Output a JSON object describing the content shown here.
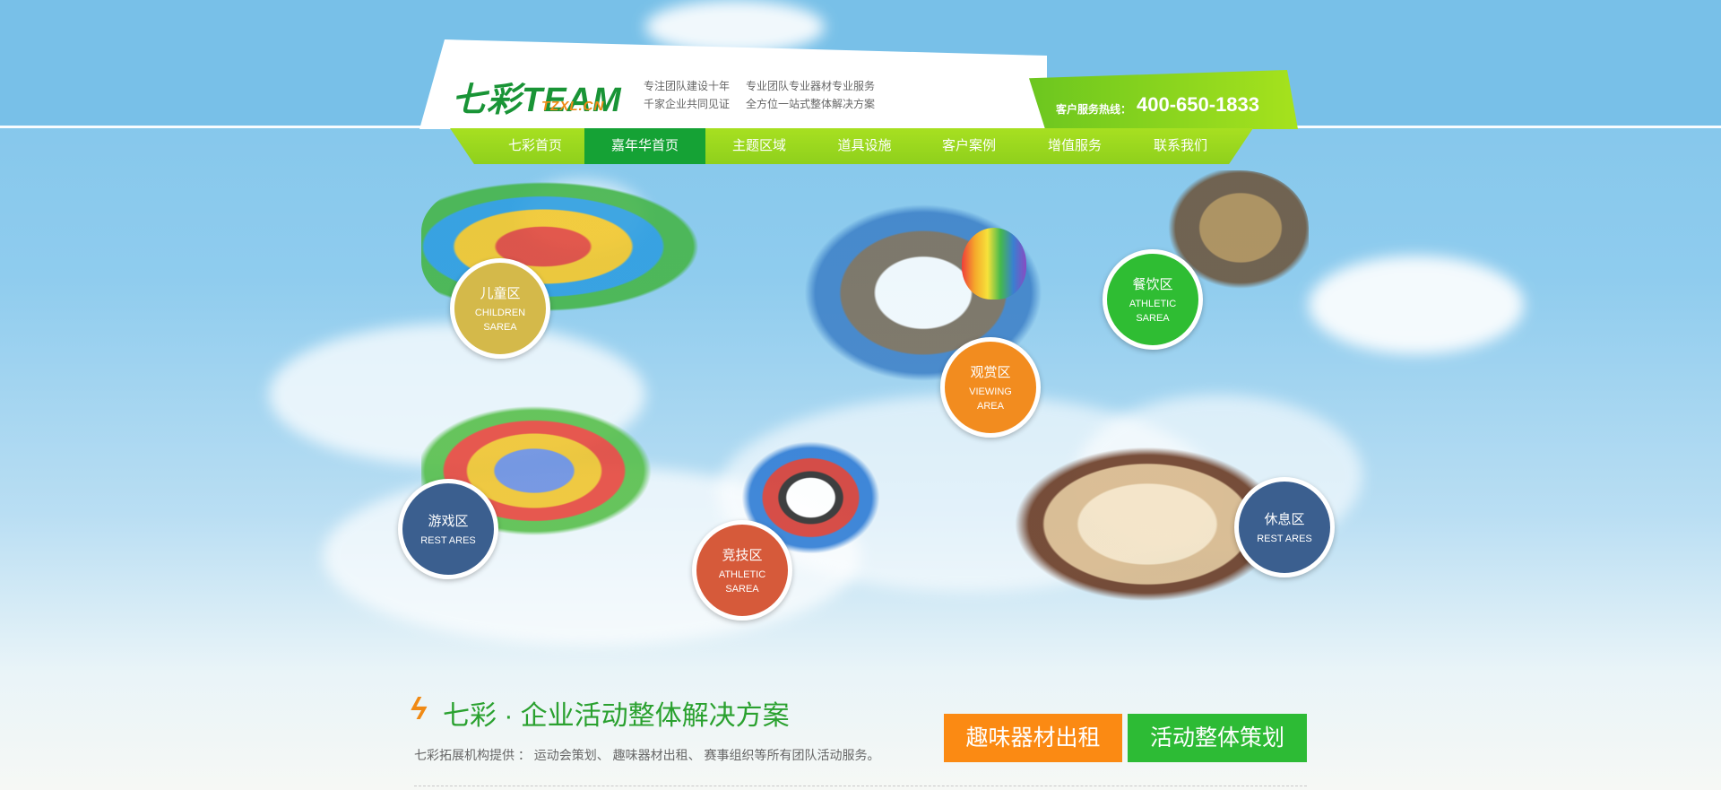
{
  "header": {
    "logo_main": "七彩TEAM",
    "logo_sub": "TZXL.CN",
    "slogans": [
      "专注团队建设十年",
      "专业团队专业器材专业服务",
      "千家企业共同见证",
      "全方位一站式整体解决方案"
    ],
    "hotline_label": "客户服务热线：",
    "hotline_number": "400-650-1833"
  },
  "nav": {
    "items": [
      {
        "label": "七彩首页",
        "active": false
      },
      {
        "label": "嘉年华首页",
        "active": true
      },
      {
        "label": "主题区域",
        "active": false
      },
      {
        "label": "道具设施",
        "active": false
      },
      {
        "label": "客户案例",
        "active": false
      },
      {
        "label": "增值服务",
        "active": false
      },
      {
        "label": "联系我们",
        "active": false
      }
    ]
  },
  "zones": [
    {
      "name": "儿童区",
      "en": "CHILDREN SAREA",
      "color": "#d4b94a"
    },
    {
      "name": "观赏区",
      "en": "VIEWING AREA",
      "color": "#f28c1f"
    },
    {
      "name": "餐饮区",
      "en": "ATHLETIC SAREA",
      "color": "#2fbd33"
    },
    {
      "name": "游戏区",
      "en": "REST ARES",
      "color": "#3b5f8f"
    },
    {
      "name": "竞技区",
      "en": "ATHLETIC SAREA",
      "color": "#d65a3a"
    },
    {
      "name": "休息区",
      "en": "REST ARES",
      "color": "#3b5f8f"
    }
  ],
  "bottom": {
    "title": "七彩 · 企业活动整体解决方案",
    "description": "七彩拓展机构提供 ： 运动会策划、 趣味器材出租、 赛事组织等所有团队活动服务。",
    "buttons": [
      {
        "label": "趣味器材出租",
        "color": "#fb8a13"
      },
      {
        "label": "活动整体策划",
        "color": "#2dbb35"
      }
    ]
  },
  "colors": {
    "brand_green": "#199436",
    "nav_green": "#9cd81f",
    "nav_active": "#15a235",
    "accent_orange": "#f08a15"
  }
}
